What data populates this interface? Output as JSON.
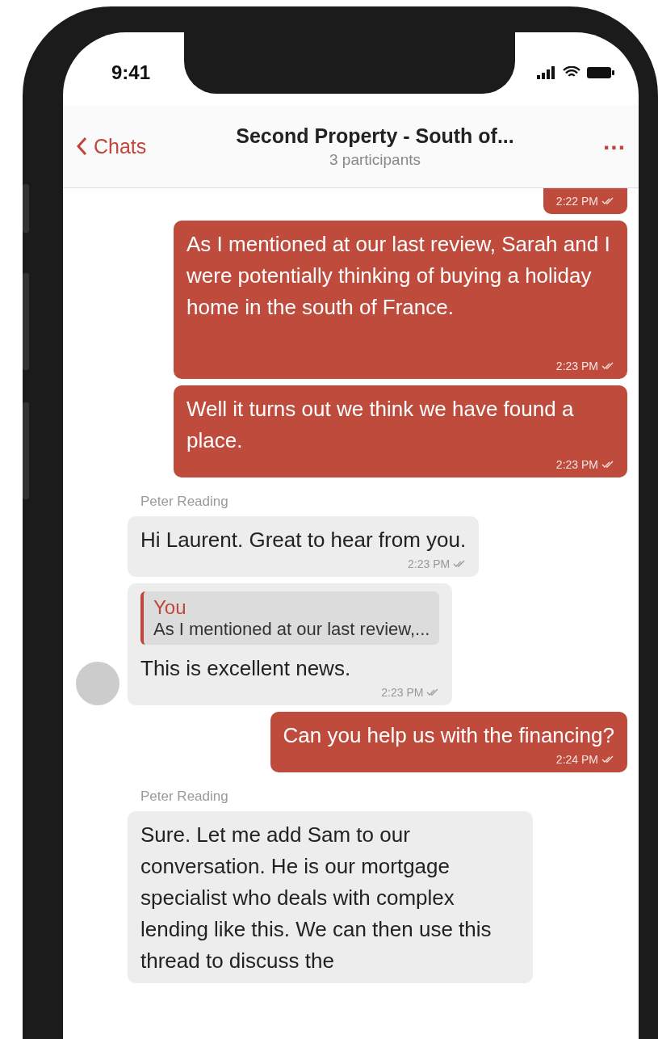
{
  "status_bar": {
    "time": "9:41"
  },
  "nav": {
    "back": "Chats",
    "title": "Second Property - South of...",
    "subtitle": "3 participants",
    "more": "..."
  },
  "messages": [
    {
      "kind": "outgoing",
      "time": "2:22 PM",
      "cut_top": true
    },
    {
      "kind": "outgoing",
      "text": "As I mentioned at our last review, Sarah and I were potentially thinking of buying a holiday home in the south of France.",
      "time": "2:23 PM",
      "tall": true
    },
    {
      "kind": "outgoing",
      "text": "Well it turns out we think we have found a place.",
      "time": "2:23 PM"
    },
    {
      "kind": "sender",
      "text": "Peter Reading"
    },
    {
      "kind": "incoming",
      "text": "Hi Laurent. Great to hear from you.",
      "time": "2:23 PM"
    },
    {
      "kind": "incoming",
      "avatar": true,
      "reply": {
        "author": "You",
        "text": "As I mentioned at our last review,..."
      },
      "text": "This is excellent news.",
      "time": "2:23 PM"
    },
    {
      "kind": "outgoing",
      "text": "Can you help us with the financing?",
      "time": "2:24 PM"
    },
    {
      "kind": "sender",
      "text": "Peter Reading"
    },
    {
      "kind": "incoming",
      "text": "Sure. Let me add Sam to our conversation. He is our mortgage specialist who deals with complex lending like this. We can then use this thread to discuss the"
    }
  ]
}
